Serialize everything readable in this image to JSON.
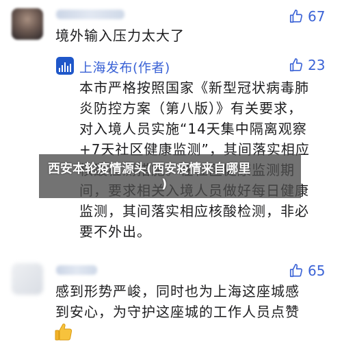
{
  "comments": [
    {
      "author": "",
      "likes": "67",
      "text": "境外输入压力太大了"
    },
    {
      "author": "上海发布(作者)",
      "likes": "23",
      "text": "本市严格按照国家《新型冠状病毒肺\n炎防控方案（第八版）》有关要求，\n对入境人员实施“14天集中隔离观察\n+7天社区健康监测”，其间落实相应\n核酸检测措施。在社区健康监测期\n间，要求相关入境人员做好每日健康\n监测，其间落实相应核酸检测，非必\n要不外出。"
    },
    {
      "author": "",
      "likes": "65",
      "text": "感到形势严峻，同时也为上海这座城感\n到安心，为守护这座城的工作人员点赞"
    }
  ],
  "overlay": {
    "title_line1": "西安本轮疫情源头(西安疫情来自哪里",
    "title_line2": ")"
  },
  "icons": {
    "like": "thumbs-up-outline-icon",
    "emoji": "thumbs-up-emoji-icon"
  },
  "colors": {
    "accent": "#3b63d6",
    "logo_bg": "#1f57c9"
  }
}
